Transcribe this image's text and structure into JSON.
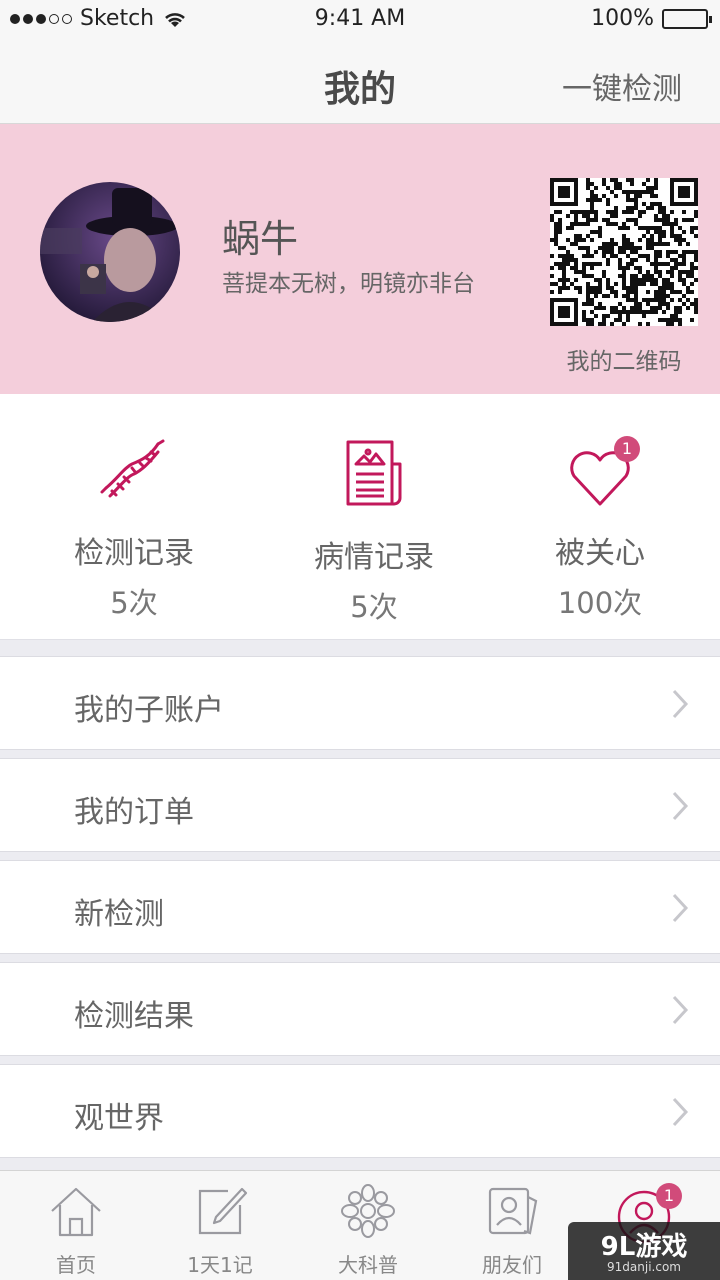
{
  "status_bar": {
    "carrier": "Sketch",
    "time": "9:41 AM",
    "battery": "100%"
  },
  "nav": {
    "title": "我的",
    "action": "一键检测"
  },
  "profile": {
    "name": "蜗牛",
    "motto": "菩提本无树，明镜亦非台",
    "qr_label": "我的二维码"
  },
  "stats": [
    {
      "label": "检测记录",
      "count": "5次",
      "icon": "dna-icon"
    },
    {
      "label": "病情记录",
      "count": "5次",
      "icon": "report-icon"
    },
    {
      "label": "被关心",
      "count": "100次",
      "icon": "heart-icon",
      "badge": "1"
    }
  ],
  "menu": [
    {
      "label": "我的子账户"
    },
    {
      "label": "我的订单"
    },
    {
      "label": "新检测"
    },
    {
      "label": "检测结果"
    },
    {
      "label": "观世界"
    }
  ],
  "tabs": [
    {
      "label": "首页",
      "icon": "home-icon"
    },
    {
      "label": "1天1记",
      "icon": "edit-icon"
    },
    {
      "label": "大科普",
      "icon": "flower-icon"
    },
    {
      "label": "朋友们",
      "icon": "contacts-icon"
    },
    {
      "label": "",
      "icon": "profile-icon",
      "badge": "1",
      "active": true
    }
  ],
  "watermark": {
    "main": "9L游戏",
    "sub": "91danji.com"
  },
  "colors": {
    "accent": "#c2185b",
    "header_bg": "#f4cedb",
    "badge": "#d14b7a"
  }
}
